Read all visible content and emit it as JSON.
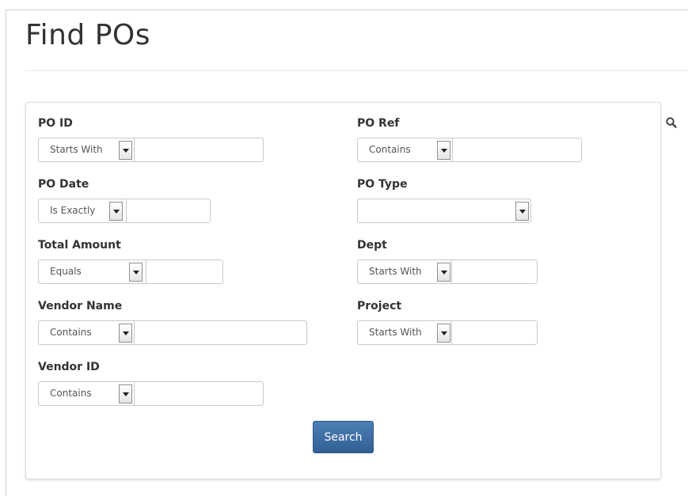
{
  "page": {
    "title": "Find POs"
  },
  "form": {
    "po_id": {
      "label": "PO ID",
      "operator": "Starts With",
      "value": ""
    },
    "po_ref": {
      "label": "PO Ref",
      "operator": "Contains",
      "value": ""
    },
    "po_date": {
      "label": "PO Date",
      "operator": "Is Exactly",
      "value": ""
    },
    "po_type": {
      "label": "PO Type",
      "value": ""
    },
    "total_amount": {
      "label": "Total Amount",
      "operator": "Equals",
      "value": ""
    },
    "dept": {
      "label": "Dept",
      "operator": "Starts With",
      "value": ""
    },
    "vendor_name": {
      "label": "Vendor Name",
      "operator": "Contains",
      "value": ""
    },
    "project": {
      "label": "Project",
      "operator": "Starts With",
      "value": ""
    },
    "vendor_id": {
      "label": "Vendor ID",
      "operator": "Contains",
      "value": ""
    },
    "search_label": "Search"
  },
  "icons": {
    "search": "search-icon",
    "dropdown": "chevron-down-icon"
  },
  "colors": {
    "button": "#3a6b9f",
    "border": "#c9c9c9"
  }
}
